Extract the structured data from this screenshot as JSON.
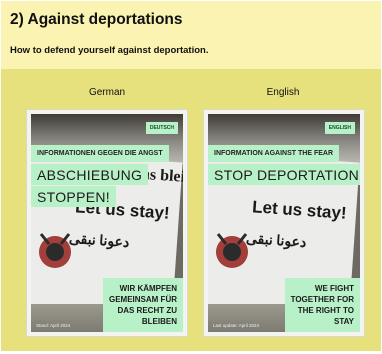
{
  "header": {
    "title": "2) Against deportations",
    "subtitle": "How to defend yourself against deportation."
  },
  "columns": [
    {
      "label": "German",
      "poster": {
        "tag": "DEUTSCH",
        "line_small": "INFORMATIONEN GEGEN DIE ANGST",
        "line_big_1": "ABSCHIEBUNG",
        "line_big_2": "STOPPEN!",
        "bottom_lines": [
          "WIR KÄMPFEN",
          "GEMEINSAM FÜR",
          "DAS RECHT ZU",
          "BLEIBEN"
        ],
        "stand": "Stand: April 2024"
      }
    },
    {
      "label": "English",
      "poster": {
        "tag": "ENGLISH",
        "line_small": "INFORMATION AGAINST THE FEAR",
        "line_big_1": "STOP DEPORTATION!",
        "bottom_lines": [
          "WE FIGHT",
          "TOGETHER FOR",
          "THE RIGHT TO",
          "STAY"
        ],
        "stand": "Last update: April 2024"
      }
    }
  ],
  "banner_text": {
    "line1": "Lasst uns bleib",
    "line2": "Let us stay!",
    "line3": "دعونا نبقى"
  },
  "colors": {
    "header_bg": "#faf3b2",
    "panel_bg": "#e6e07d",
    "highlight": "#b8f0c8"
  }
}
